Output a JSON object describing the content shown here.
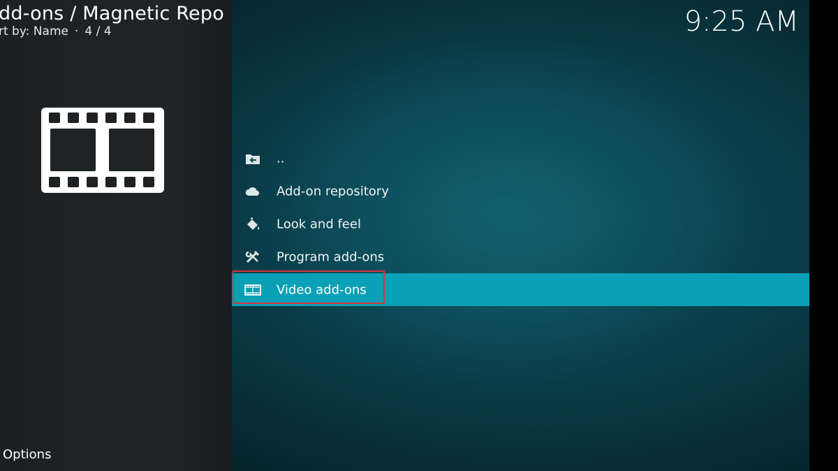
{
  "header": {
    "title": "dd-ons / Magnetic Repo",
    "sort_label": "rt by: Name",
    "count": "4 / 4",
    "separator": "·"
  },
  "clock": {
    "time": "9:25 AM"
  },
  "preview": {
    "icon": "film-strip-icon"
  },
  "footer": {
    "options_label": "Options"
  },
  "list": {
    "items": [
      {
        "label": "..",
        "icon": "folder-back-icon"
      },
      {
        "label": "Add-on repository",
        "icon": "cloud-icon"
      },
      {
        "label": "Look and feel",
        "icon": "paint-bucket-icon"
      },
      {
        "label": "Program add-ons",
        "icon": "tools-icon"
      },
      {
        "label": "Video add-ons",
        "icon": "film-icon",
        "selected": true
      }
    ]
  },
  "colors": {
    "selection": "#0aa0b6",
    "highlight_border": "#d9343f",
    "left_panel": "#202426",
    "background": "#0a3c48"
  }
}
